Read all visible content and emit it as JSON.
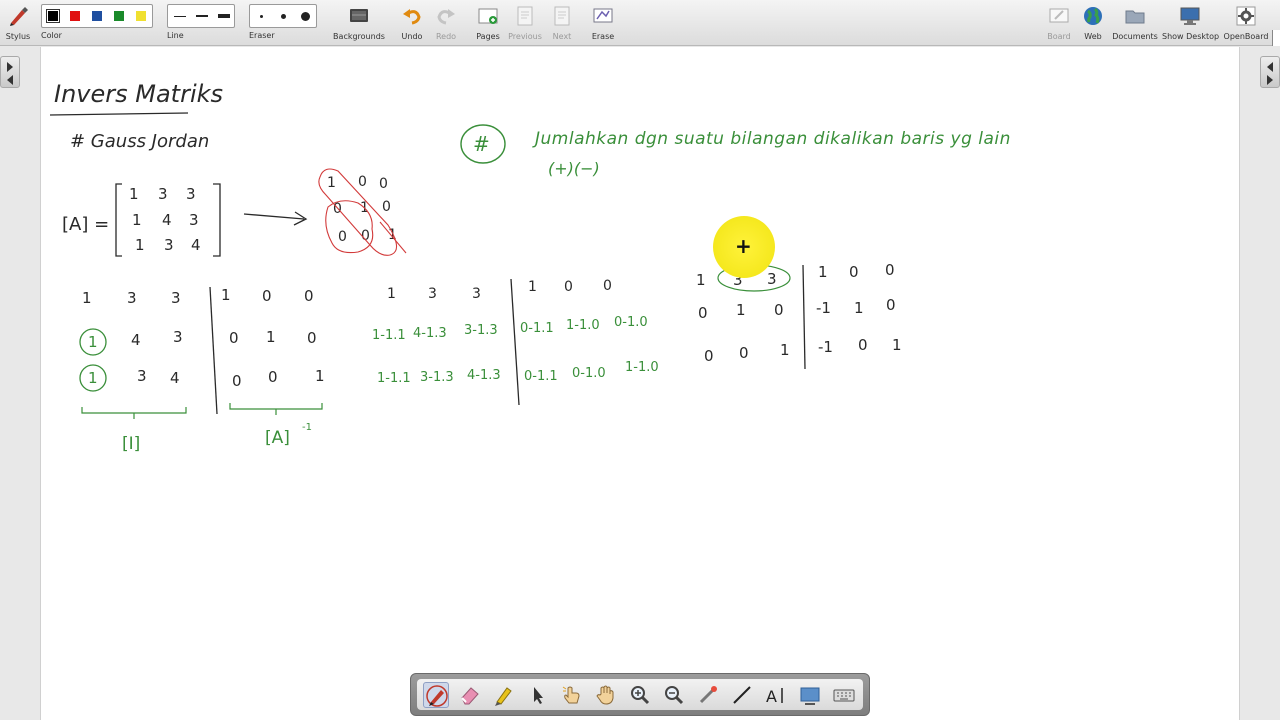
{
  "toolbar": {
    "stylus": "Stylus",
    "color": "Color",
    "line": "Line",
    "eraser": "Eraser",
    "backgrounds": "Backgrounds",
    "undo": "Undo",
    "redo": "Redo",
    "pages": "Pages",
    "previous": "Previous",
    "next": "Next",
    "erase": "Erase",
    "board": "Board",
    "web": "Web",
    "documents": "Documents",
    "show_desktop": "Show Desktop",
    "openboard": "OpenBoard",
    "colors": [
      "#000000",
      "#e01010",
      "#1f4fa0",
      "#1a8a2a",
      "#f0e030"
    ]
  },
  "ink": {
    "title": "Invers Matriks",
    "subtitle": "# Gauss Jordan",
    "a_label": "[A] =",
    "matrix_a": [
      [
        "1",
        "3",
        "3"
      ],
      [
        "1",
        "4",
        "3"
      ],
      [
        "1",
        "3",
        "4"
      ]
    ],
    "identity": [
      [
        "1",
        "0",
        "0"
      ],
      [
        "0",
        "1",
        "0"
      ],
      [
        "0",
        "0",
        "1"
      ]
    ],
    "note_mark": "#",
    "note_text": "Jumlahkan dgn suatu bilangan dikalikan baris yg lain",
    "note_ops": "(+)(−)",
    "aug1_left": [
      [
        "1",
        "3",
        "3"
      ],
      [
        "1",
        "4",
        "3"
      ],
      [
        "1",
        "3",
        "4"
      ]
    ],
    "aug1_right": [
      [
        "1",
        "0",
        "0"
      ],
      [
        "0",
        "1",
        "0"
      ],
      [
        "0",
        "0",
        "1"
      ]
    ],
    "label_I": "[I]",
    "label_Ainv": "[A]",
    "label_Ainv_sup": "-1",
    "aug2_left": [
      [
        "1",
        "3",
        "3"
      ],
      [
        "1-1.1",
        "4-1.3",
        "3-1.3"
      ],
      [
        "1-1.1",
        "3-1.3",
        "4-1.3"
      ]
    ],
    "aug2_right": [
      [
        "1",
        "0",
        "0"
      ],
      [
        "0-1.1",
        "1-1.0",
        "0-1.0"
      ],
      [
        "0-1.1",
        "0-1.0",
        "1-1.0"
      ]
    ],
    "aug3_left": [
      [
        "1",
        "3",
        "3"
      ],
      [
        "0",
        "1",
        "0"
      ],
      [
        "0",
        "0",
        "1"
      ]
    ],
    "aug3_right": [
      [
        "1",
        "0",
        "0"
      ],
      [
        "-1",
        "1",
        "0"
      ],
      [
        "-1",
        "0",
        "1"
      ]
    ]
  },
  "colors": {
    "ink_black": "#2a2a2a",
    "ink_green": "#3a8f3a",
    "ink_red": "#d23a3a",
    "cursor_highlight": "#f5e81e"
  }
}
